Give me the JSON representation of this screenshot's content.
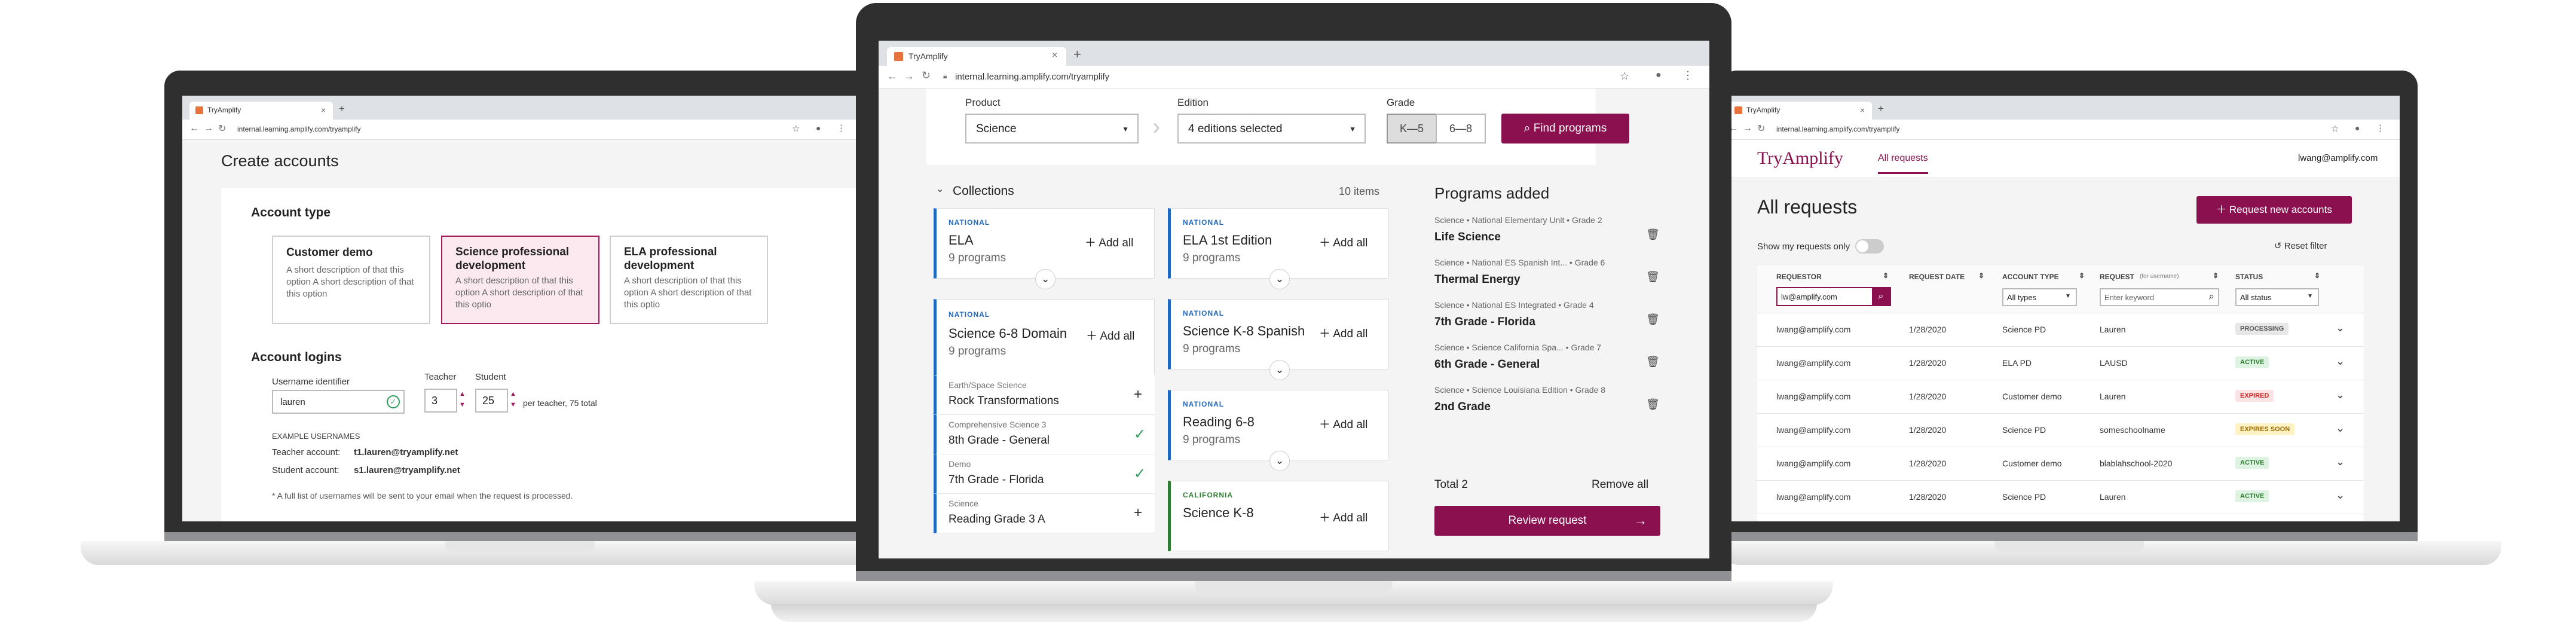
{
  "browser": {
    "tab_title": "TryAmplify",
    "new_tab": "+",
    "close": "×",
    "back": "←",
    "forward": "→",
    "reload": "↻",
    "url": "internal.learning.amplify.com/tryamplify"
  },
  "left": {
    "page_title": "Create accounts",
    "account_type_heading": "Account type",
    "account_types": [
      {
        "title": "Customer demo",
        "desc": "A short description of that this option A short description of that this option"
      },
      {
        "title": "Science professional development",
        "desc": "A short description of that this option A short description of that this optio"
      },
      {
        "title": "ELA professional development",
        "desc": "A short description of that this option A short description of that this optio"
      }
    ],
    "logins_heading": "Account logins",
    "username_label": "Username identifier",
    "username_value": "lauren",
    "teacher_label": "Teacher",
    "teacher_value": "3",
    "student_label": "Student",
    "student_value": "25",
    "per_teacher": "per teacher, 75 total",
    "examples_heading": "EXAMPLE USERNAMES",
    "teacher_account_label": "Teacher account:",
    "teacher_account_value": "t1.lauren@tryamplify.net",
    "student_account_label": "Student account:",
    "student_account_value": "s1.lauren@tryamplify.net",
    "footnote": "* A full list of usernames will be sent to your email when the request is processed."
  },
  "center": {
    "product_label": "Product",
    "product_value": "Science",
    "edition_label": "Edition",
    "edition_value": "4 editions selected",
    "grade_label": "Grade",
    "grade_options": [
      "K—5",
      "6—8"
    ],
    "find_button": "Find programs",
    "collections_heading": "Collections",
    "collections_count": "10 items",
    "add_all": "Add all",
    "col1": [
      {
        "tag": "NATIONAL",
        "name": "ELA",
        "count": "9 programs"
      },
      {
        "tag": "NATIONAL",
        "name": "Science 6-8 Domain",
        "count": "9 programs"
      }
    ],
    "sub_items": [
      {
        "line1": "Earth/Space Science",
        "line2": "Rock Transformations",
        "state": "add"
      },
      {
        "line1": "Comprehensive Science 3",
        "line2": "8th Grade - General",
        "state": "added"
      },
      {
        "line1": "Demo",
        "line2": "7th Grade - Florida",
        "state": "added"
      },
      {
        "line1": "Science",
        "line2": "Reading Grade 3 A",
        "state": "add"
      }
    ],
    "col2": [
      {
        "tag": "NATIONAL",
        "name": "ELA 1st Edition",
        "count": "9 programs"
      },
      {
        "tag": "NATIONAL",
        "name": "Science K-8 Spanish",
        "count": "9 programs"
      },
      {
        "tag": "NATIONAL",
        "name": "Reading 6-8",
        "count": "9 programs"
      },
      {
        "tag": "CALIFORNIA",
        "name": "Science K-8",
        "count": ""
      }
    ],
    "programs_heading": "Programs added",
    "programs": [
      {
        "line1": "Science • National Elementary Unit • Grade 2",
        "line2": "Life Science"
      },
      {
        "line1": "Science • National ES Spanish Int... • Grade 6",
        "line2": "Thermal Energy"
      },
      {
        "line1": "Science • National ES Integrated • Grade 4",
        "line2": "7th Grade - Florida"
      },
      {
        "line1": "Science • Science California Spa... • Grade 7",
        "line2": "6th Grade - General"
      },
      {
        "line1": "Science • Science Louisiana Edition • Grade 8",
        "line2": "2nd Grade"
      }
    ],
    "total": "Total 2",
    "remove_all": "Remove all",
    "review_button": "Review request"
  },
  "right": {
    "logo": "TryAmplify",
    "nav_tab": "All requests",
    "user_email": "lwang@amplify.com",
    "page_title": "All requests",
    "new_request_button": "Request new accounts",
    "show_my_label": "Show my requests only",
    "reset_filter": "Reset filter",
    "columns": [
      "REQUESTOR",
      "REQUEST DATE",
      "ACCOUNT TYPE",
      "REQUEST",
      "STATUS"
    ],
    "request_column_sub": "(for username)",
    "search_value": "lw@amplify.com",
    "account_type_filter": "All types",
    "request_placeholder": "Enter keyword",
    "status_filter": "All status",
    "rows": [
      {
        "requestor": "lwang@amplify.com",
        "date": "1/28/2020",
        "type": "Science PD",
        "request": "Lauren",
        "status": "PROCESSING",
        "kind": "proc"
      },
      {
        "requestor": "lwang@amplify.com",
        "date": "1/28/2020",
        "type": "ELA PD",
        "request": "LAUSD",
        "status": "ACTIVE",
        "kind": "act"
      },
      {
        "requestor": "lwang@amplify.com",
        "date": "1/28/2020",
        "type": "Customer demo",
        "request": "Lauren",
        "status": "EXPIRED",
        "kind": "exp"
      },
      {
        "requestor": "lwang@amplify.com",
        "date": "1/28/2020",
        "type": "Science PD",
        "request": "someschoolname",
        "status": "EXPIRES SOON",
        "kind": "soon"
      },
      {
        "requestor": "lwang@amplify.com",
        "date": "1/28/2020",
        "type": "Customer demo",
        "request": "blablahschool-2020",
        "status": "ACTIVE",
        "kind": "act"
      },
      {
        "requestor": "lwang@amplify.com",
        "date": "1/28/2020",
        "type": "Science PD",
        "request": "Lauren",
        "status": "ACTIVE",
        "kind": "act"
      }
    ]
  },
  "colors": {
    "brand": "#8a1050",
    "national_tag": "#1f69c1",
    "california_tag": "#2e7d32",
    "check": "#2e9b5a"
  }
}
